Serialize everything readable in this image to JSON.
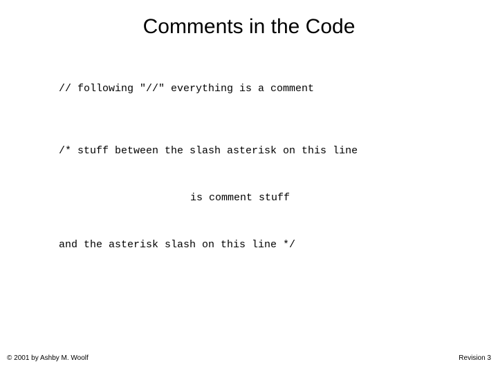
{
  "title": "Comments in the Code",
  "code": {
    "line1": "// following \"//\" everything is a comment",
    "line2": "/* stuff between the slash asterisk on this line",
    "line3": "is comment stuff",
    "line4": "and the asterisk slash on this line */"
  },
  "footer": {
    "copyright": "© 2001 by Ashby M. Woolf",
    "revision": "Revision 3"
  }
}
